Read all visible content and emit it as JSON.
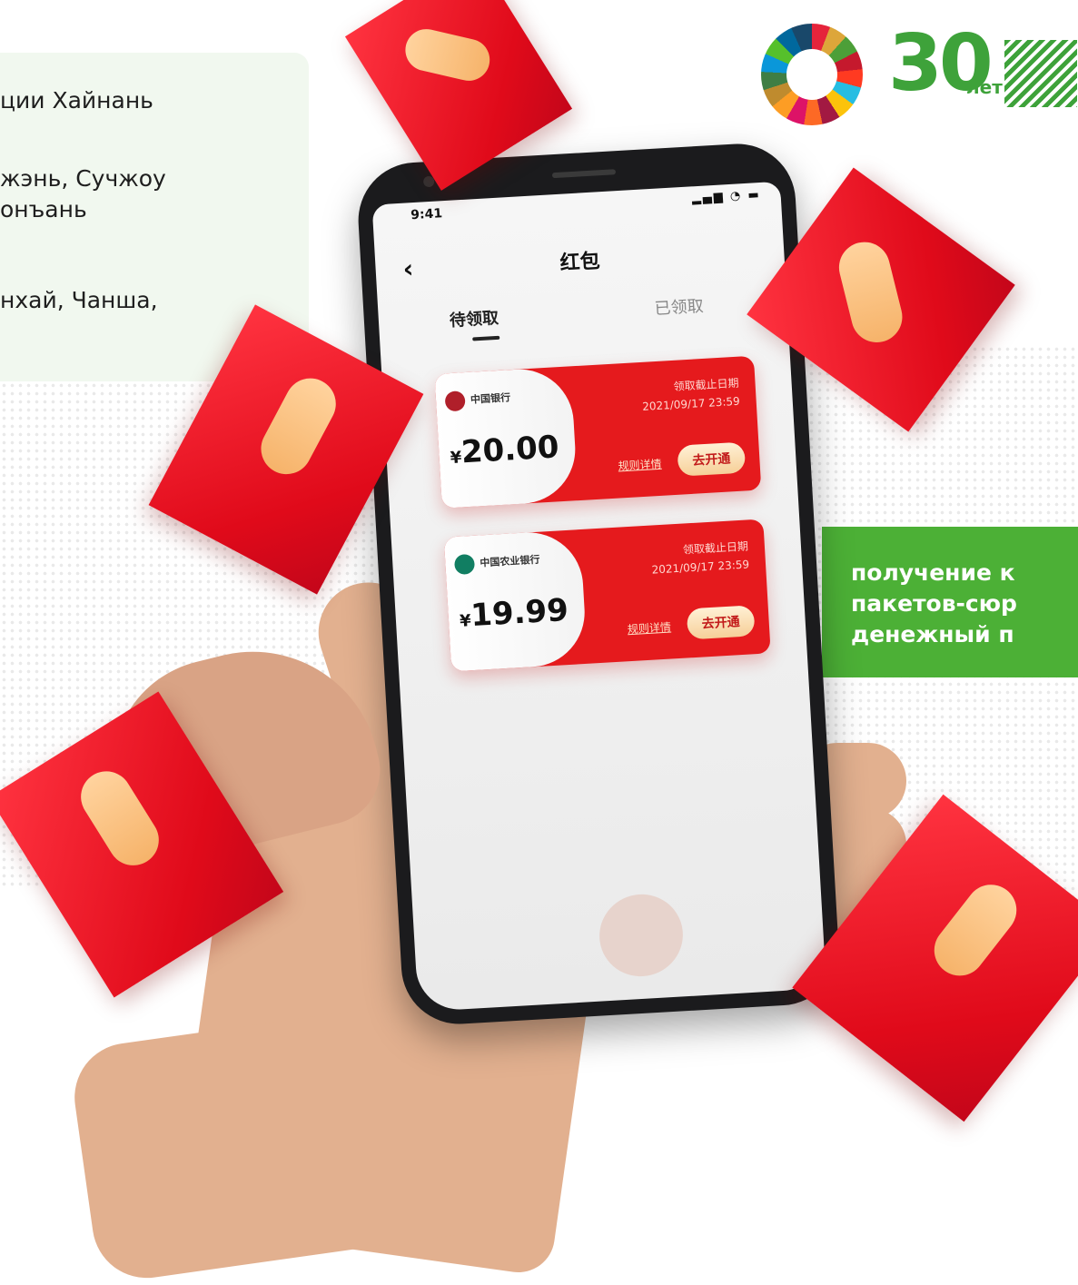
{
  "info_panel": {
    "lines": [
      "ции Хайнань",
      "жэнь, Сучжоу",
      "онъань",
      "нхай, Чанша,"
    ]
  },
  "logos": {
    "anniversary_number": "30",
    "anniversary_suffix": "лет"
  },
  "caption": {
    "lines": [
      "получение к",
      "пакетов-сюр",
      "денежный п"
    ]
  },
  "phone": {
    "status_time": "9:41",
    "status_icons": "▂▄▆ ◔ ▬",
    "back_icon": "‹",
    "title": "红包",
    "tabs": [
      {
        "label": "待领取",
        "active": true
      },
      {
        "label": "已领取",
        "active": false
      }
    ],
    "coupons": [
      {
        "bank": "中国银行",
        "currency": "¥",
        "amount": "20.00",
        "deadline_label": "领取截止日期",
        "deadline": "2021/09/17 23:59",
        "rules_link": "规则详情",
        "button": "去开通"
      },
      {
        "bank": "中国农业银行",
        "currency": "¥",
        "amount": "19.99",
        "deadline_label": "领取截止日期",
        "deadline": "2021/09/17 23:59",
        "rules_link": "规则详情",
        "button": "去开通"
      }
    ]
  },
  "colors": {
    "brand_green": "#4cb036",
    "envelope_red": "#e51a1d",
    "panel_bg": "#f1f8ef"
  }
}
